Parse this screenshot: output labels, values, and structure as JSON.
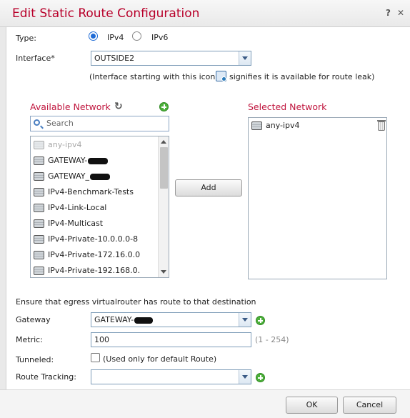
{
  "dialog": {
    "title": "Edit Static Route Configuration",
    "help_label": "?",
    "close_label": "✕"
  },
  "form": {
    "type_label": "Type:",
    "ipv4_label": "IPv4",
    "ipv6_label": "IPv6",
    "type_selected": "IPv4",
    "interface_label": "Interface*",
    "interface_value": "OUTSIDE2",
    "interface_note_before": "(Interface starting with this icon",
    "interface_note_after": "signifies it is available for route leak)"
  },
  "available": {
    "title": "Available Network",
    "search_placeholder": "Search",
    "items": [
      "any-ipv4",
      "GATEWAY-",
      "GATEWAY_",
      "IPv4-Benchmark-Tests",
      "IPv4-Link-Local",
      "IPv4-Multicast",
      "IPv4-Private-10.0.0.0-8",
      "IPv4-Private-172.16.0.0",
      "IPv4-Private-192.168.0."
    ]
  },
  "add_button": "Add",
  "selected": {
    "title": "Selected Network",
    "items": [
      "any-ipv4"
    ]
  },
  "egress_note": "Ensure that egress virtualrouter has route to that destination",
  "gateway": {
    "label": "Gateway",
    "value": "GATEWAY-"
  },
  "metric": {
    "label": "Metric:",
    "value": "100",
    "range": "(1 - 254)"
  },
  "tunneled": {
    "label": "Tunneled:",
    "note": "(Used only for default Route)"
  },
  "route_tracking": {
    "label": "Route Tracking:",
    "value": ""
  },
  "footer": {
    "ok": "OK",
    "cancel": "Cancel"
  },
  "colors": {
    "title_red": "#b8002a",
    "section_red": "#c0163e",
    "radio_blue": "#1e6bd6",
    "plus_green": "#4caf3a"
  }
}
